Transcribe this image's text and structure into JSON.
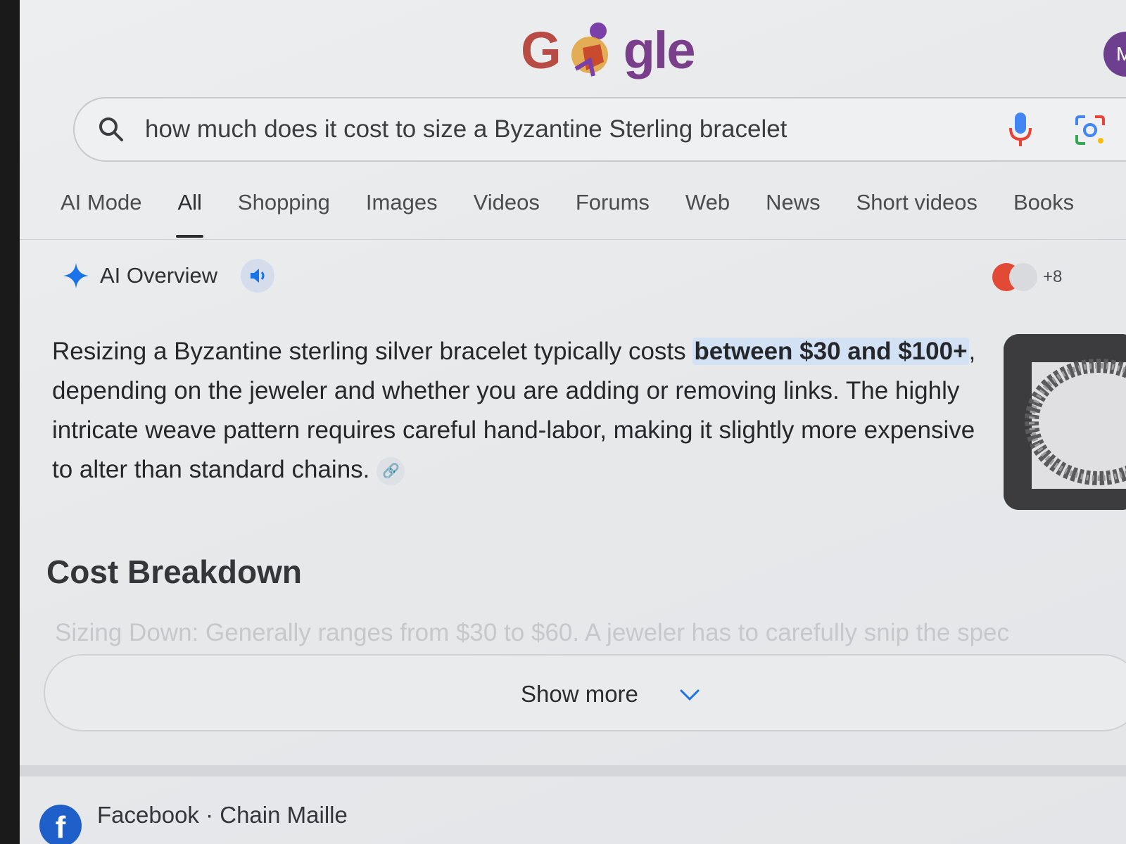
{
  "logo": {
    "first": "G",
    "rest": "gle",
    "doodle_icon": "soccer-player-doodle-icon"
  },
  "avatar": {
    "initial": "M"
  },
  "search": {
    "value": "how much does it cost to size a Byzantine Sterling bracelet",
    "icons": [
      "search-icon",
      "mic-icon",
      "lens-icon"
    ]
  },
  "tabs": [
    {
      "label": "AI Mode",
      "active": false
    },
    {
      "label": "All",
      "active": true
    },
    {
      "label": "Shopping",
      "active": false
    },
    {
      "label": "Images",
      "active": false
    },
    {
      "label": "Videos",
      "active": false
    },
    {
      "label": "Forums",
      "active": false
    },
    {
      "label": "Web",
      "active": false
    },
    {
      "label": "News",
      "active": false
    },
    {
      "label": "Short videos",
      "active": false
    },
    {
      "label": "Books",
      "active": false
    }
  ],
  "ai_overview": {
    "title": "AI Overview",
    "source_count": "+8",
    "answer": {
      "pre": "Resizing a Byzantine sterling silver bracelet typically costs ",
      "highlight": "between $30 and $100+",
      "post": ", depending on the jeweler and whether you are adding or removing links. The highly intricate weave pattern requires careful hand-labor, making it slightly more expensive to alter than standard chains."
    }
  },
  "cost_breakdown": {
    "heading": "Cost Breakdown",
    "first_item_faded": "Sizing Down: Generally ranges from $30 to $60. A jeweler has to carefully snip the spec"
  },
  "show_more": {
    "label": "Show more"
  },
  "result": {
    "source": "Facebook · Chain Maille"
  },
  "colors": {
    "highlight": "#d3e1f4",
    "accent_blue": "#1a73e8",
    "reddit": "#e24a35"
  }
}
